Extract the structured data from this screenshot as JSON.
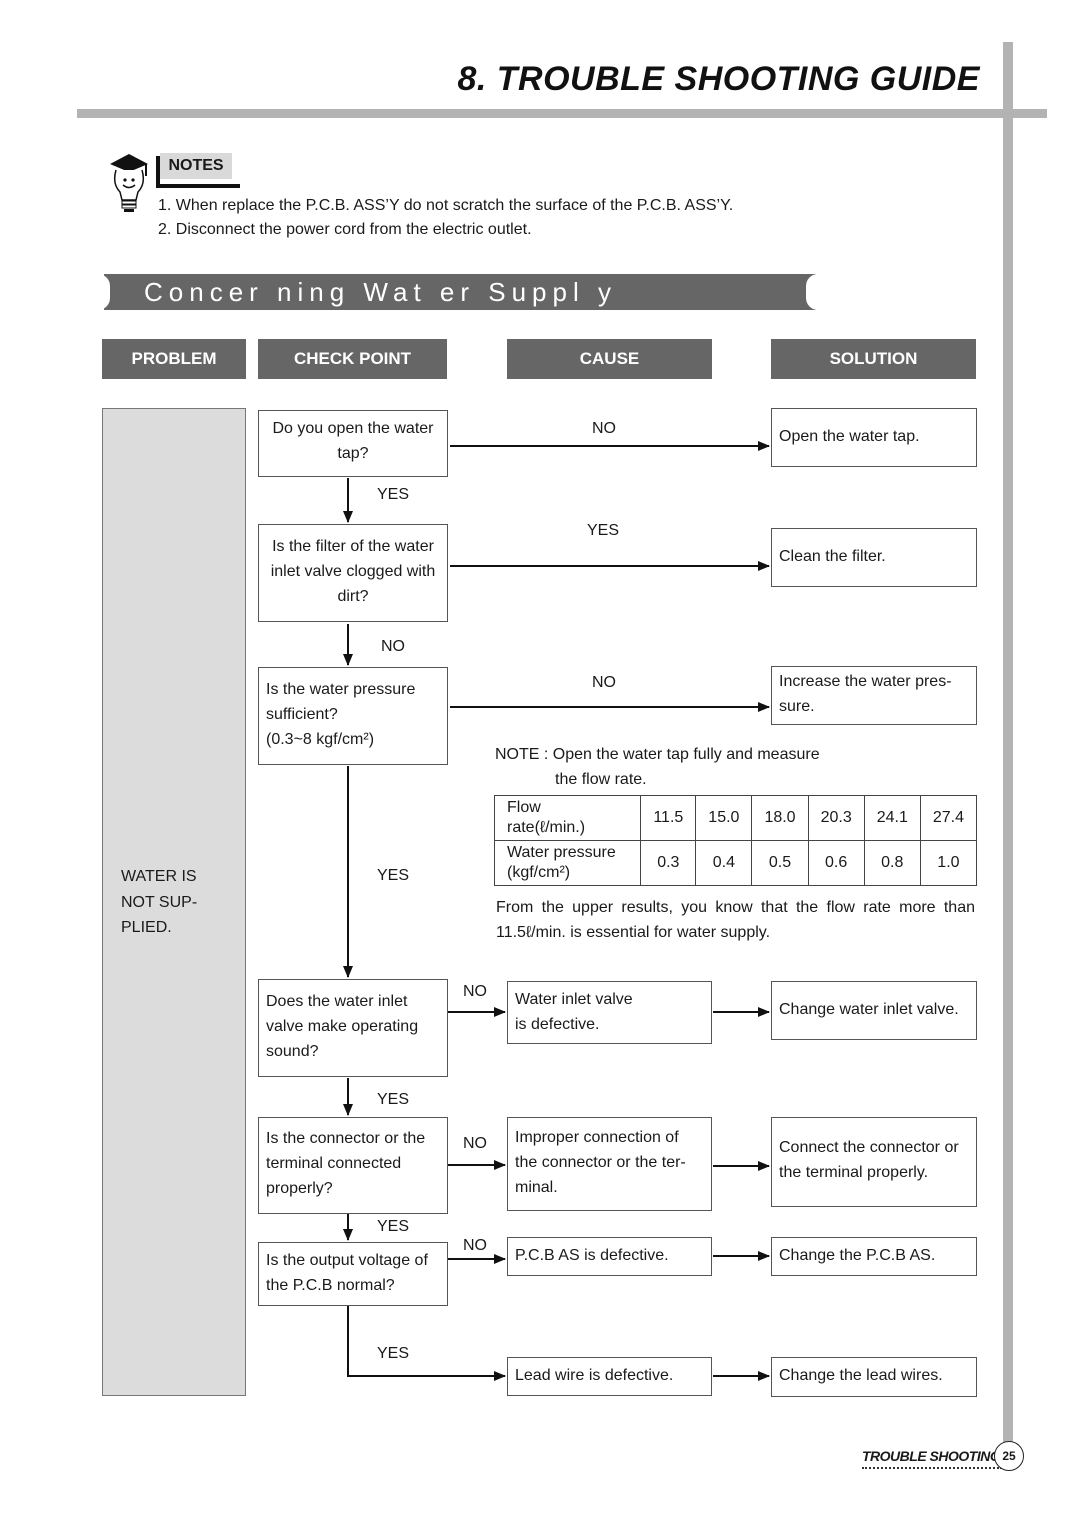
{
  "header": {
    "title": "8. TROUBLE SHOOTING GUIDE"
  },
  "notes": {
    "label": "NOTES",
    "icon": "lightbulb-graduate-icon",
    "items": [
      "1. When replace the P.C.B. ASS’Y do not scratch the surface of the P.C.B. ASS’Y.",
      "2. Disconnect the power cord from the electric outlet."
    ]
  },
  "section": {
    "title": "Concer ning Wat er  Suppl y"
  },
  "columns": {
    "problem": "PROBLEM",
    "check_point": "CHECK POINT",
    "cause": "CAUSE",
    "solution": "SOLUTION"
  },
  "problem": {
    "lines": [
      "WATER IS",
      "NOT SUP-",
      "PLIED."
    ]
  },
  "checks": [
    {
      "lines": [
        "Do you open the water",
        "tap?"
      ]
    },
    {
      "lines": [
        "Is the filter of the water",
        "inlet valve clogged with",
        "dirt?"
      ]
    },
    {
      "lines": [
        "Is the water pressure",
        "sufficient?",
        "(0.3~8 kgf/cm²)"
      ]
    },
    {
      "lines": [
        "Does the water inlet",
        "valve make operating",
        "sound?"
      ]
    },
    {
      "lines": [
        "Is the connector or the",
        "terminal connected",
        "properly?"
      ]
    },
    {
      "lines": [
        "Is the output voltage of",
        "the P.C.B normal?"
      ]
    }
  ],
  "flow_labels": {
    "c1_right": "NO",
    "c1_down": "YES",
    "c2_right": "YES",
    "c2_down": "NO",
    "c3_right": "NO",
    "c3_down": "YES",
    "c4_right": "NO",
    "c4_down": "YES",
    "c5_right": "NO",
    "c5_down": "YES",
    "c6_right": "NO",
    "c6_down": "YES"
  },
  "causes": [
    {
      "lines": [
        "Water inlet valve",
        "is defective."
      ]
    },
    {
      "lines": [
        "Improper connection of",
        "the connector or the ter-",
        "minal."
      ]
    },
    {
      "lines": [
        "P.C.B AS is defective."
      ]
    },
    {
      "lines": [
        "Lead wire is defective."
      ]
    }
  ],
  "solutions": [
    {
      "lines": [
        "Open the water tap."
      ]
    },
    {
      "lines": [
        "Clean the filter."
      ]
    },
    {
      "lines": [
        "Increase the water pres-",
        "sure."
      ]
    },
    {
      "lines": [
        "Change water inlet valve."
      ]
    },
    {
      "lines": [
        "Connect the connector or",
        "the terminal properly."
      ]
    },
    {
      "lines": [
        "Change the P.C.B AS."
      ]
    },
    {
      "lines": [
        "Change the lead wires."
      ]
    }
  ],
  "flow_note": {
    "line1": "NOTE : Open the water tap fully and measure",
    "line2": "the flow rate.",
    "table": {
      "row1_head": [
        "Flow",
        "rate(ℓ/min.)"
      ],
      "row1_values": [
        "11.5",
        "15.0",
        "18.0",
        "20.3",
        "24.1",
        "27.4"
      ],
      "row2_head": [
        "Water pressure",
        "(kgf/cm²)"
      ],
      "row2_values": [
        "0.3",
        "0.4",
        "0.5",
        "0.6",
        "0.8",
        "1.0"
      ]
    },
    "conclusion1": "From the upper results, you know that the flow rate more than",
    "conclusion2": "11.5ℓ/min. is essential for water supply."
  },
  "footer": {
    "section": "TROUBLE SHOOTING",
    "page": "25"
  }
}
